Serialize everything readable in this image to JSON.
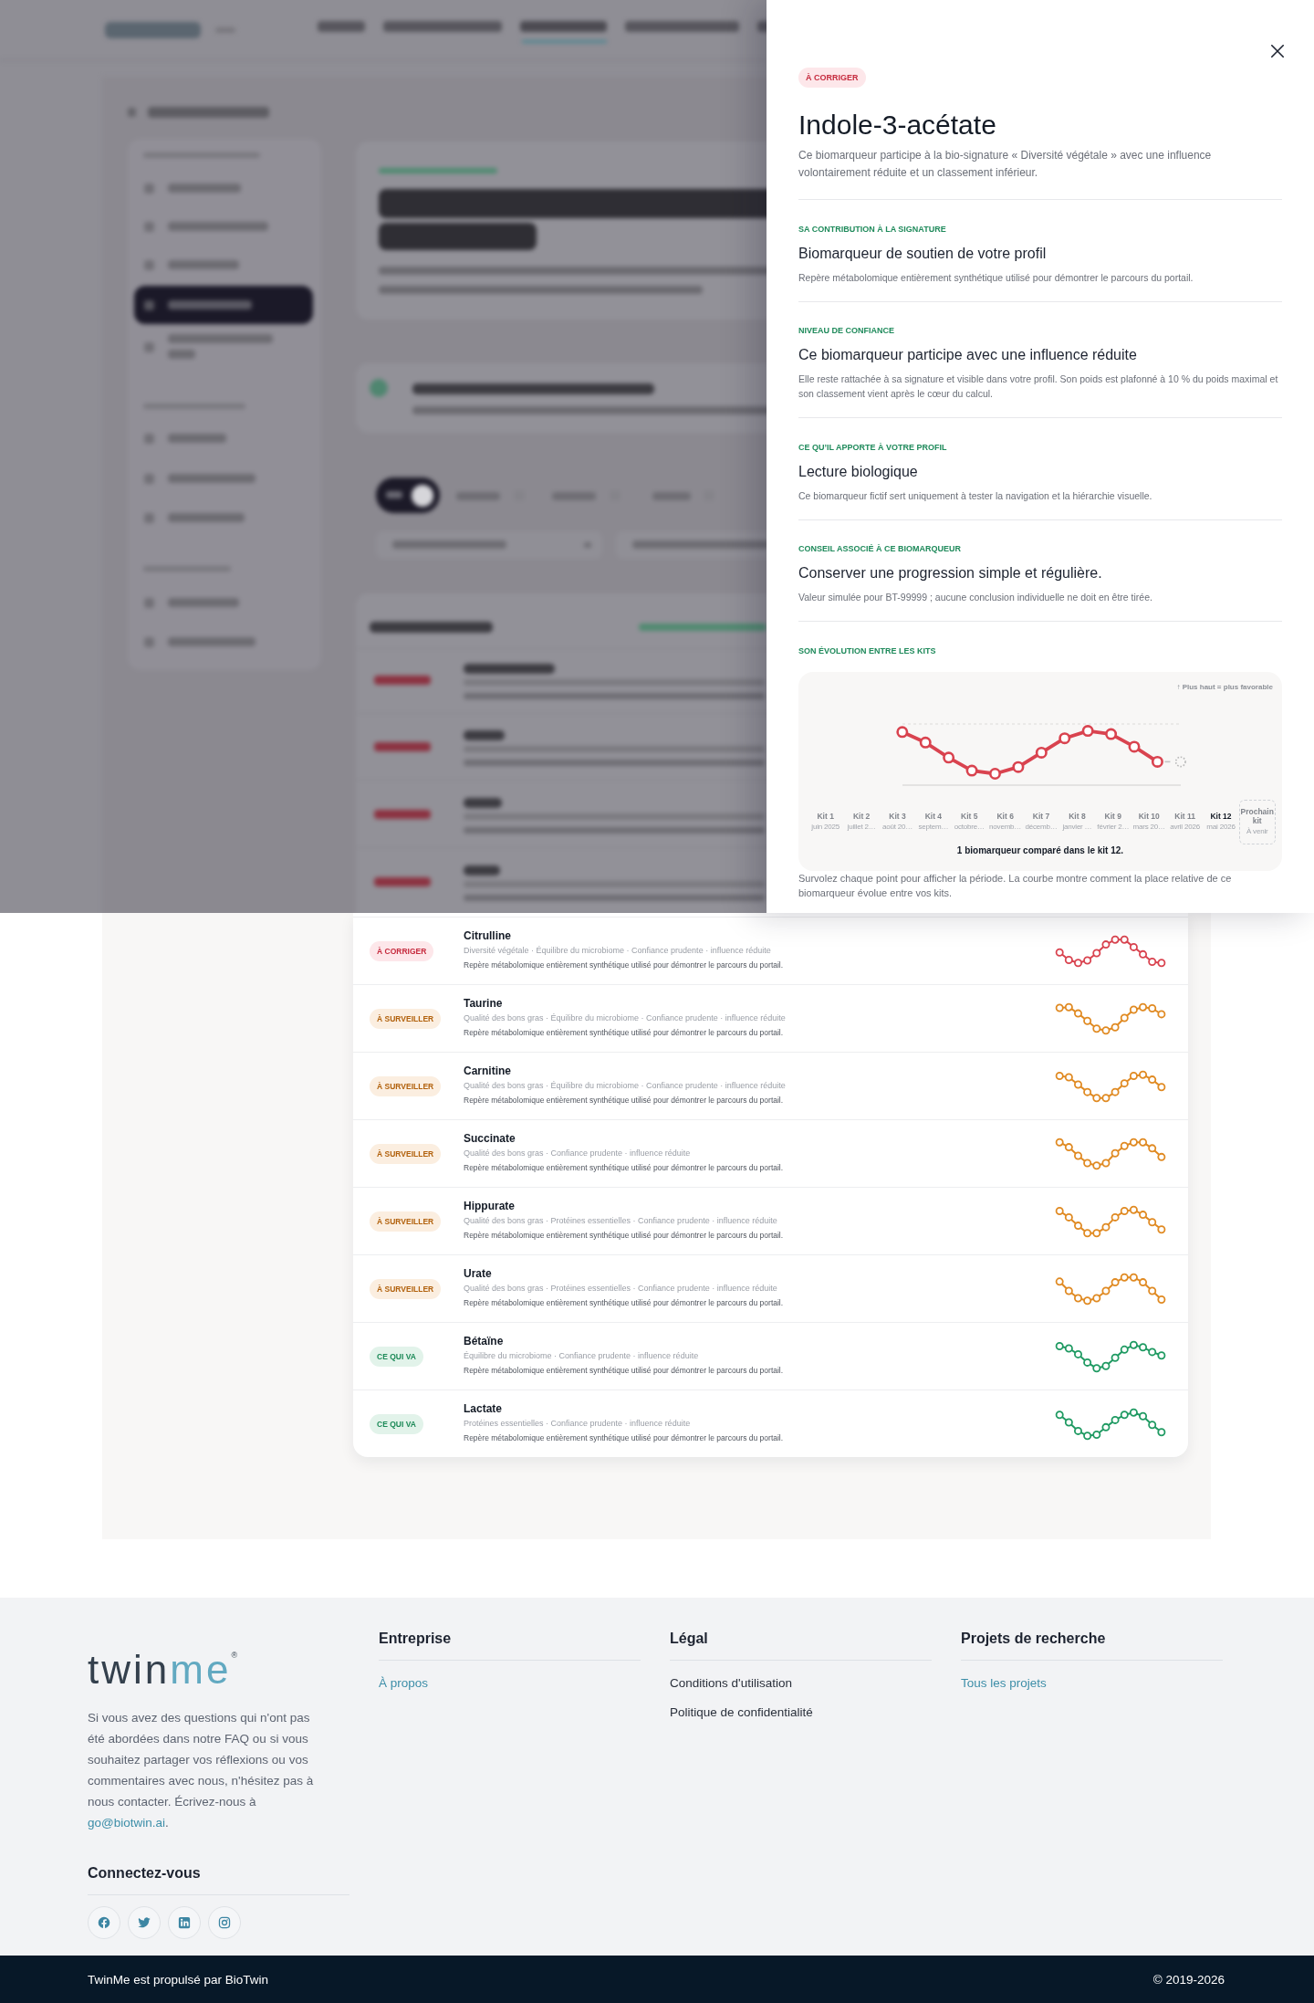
{
  "drawer": {
    "status": {
      "label": "À CORRIGER",
      "kind": "alert"
    },
    "title": "Indole-3-acétate",
    "description": "Ce biomarqueur participe à la bio-signature « Diversité végétale » avec une influence volontairement réduite et un classement inférieur.",
    "sections": [
      {
        "label": "SA CONTRIBUTION À LA SIGNATURE",
        "heading": "Biomarqueur de soutien de votre profil",
        "text": "Repère métabolomique entièrement synthétique utilisé pour démontrer le parcours du portail."
      },
      {
        "label": "NIVEAU DE CONFIANCE",
        "heading": "Ce biomarqueur participe avec une influence réduite",
        "text": "Elle reste rattachée à sa signature et visible dans votre profil. Son poids est plafonné à 10 % du poids maximal et son classement vient après le cœur du calcul."
      },
      {
        "label": "CE QU’IL APPORTE À VOTRE PROFIL",
        "heading": "Lecture biologique",
        "text": "Ce biomarqueur fictif sert uniquement à tester la navigation et la hiérarchie visuelle."
      },
      {
        "label": "CONSEIL ASSOCIÉ À CE BIOMARQUEUR",
        "heading": "Conserver une progression simple et régulière.",
        "text": "Valeur simulée pour BT-99999 ; aucune conclusion individuelle ne doit en être tirée."
      }
    ],
    "evolution": {
      "label": "SON ÉVOLUTION ENTRE LES KITS",
      "legend": "↑ Plus haut = plus favorable",
      "kits": [
        {
          "label": "Kit 1",
          "date": "juin 2025",
          "selected": false
        },
        {
          "label": "Kit 2",
          "date": "juillet 2…",
          "selected": false
        },
        {
          "label": "Kit 3",
          "date": "août 20…",
          "selected": false
        },
        {
          "label": "Kit 4",
          "date": "septem…",
          "selected": false
        },
        {
          "label": "Kit 5",
          "date": "octobre…",
          "selected": false
        },
        {
          "label": "Kit 6",
          "date": "novemb…",
          "selected": false
        },
        {
          "label": "Kit 7",
          "date": "décemb…",
          "selected": false
        },
        {
          "label": "Kit 8",
          "date": "janvier …",
          "selected": false
        },
        {
          "label": "Kit 9",
          "date": "février 2…",
          "selected": false
        },
        {
          "label": "Kit 10",
          "date": "mars 20…",
          "selected": false
        },
        {
          "label": "Kit 11",
          "date": "avril 2026",
          "selected": false
        },
        {
          "label": "Kit 12",
          "date": "mai 2026",
          "selected": true
        }
      ],
      "next_kit": {
        "label": "Prochain kit",
        "note": "À venir"
      },
      "summary": "1 biomarqueur comparé dans le kit 12.",
      "caption": "Survolez chaque point pour afficher la période. La courbe montre comment la place relative de ce biomarqueur évolue entre vos kits."
    }
  },
  "biomarkers": [
    {
      "status": "À CORRIGER",
      "kind": "alert",
      "name": "Citrulline",
      "tags": "Diversité végétale · Équilibre du microbiome · Confiance prudente · influence réduite",
      "description": "Repère métabolomique entièrement synthétique utilisé pour démontrer le parcours du portail."
    },
    {
      "status": "À SURVEILLER",
      "kind": "watch",
      "name": "Taurine",
      "tags": "Qualité des bons gras · Équilibre du microbiome · Confiance prudente · influence réduite",
      "description": "Repère métabolomique entièrement synthétique utilisé pour démontrer le parcours du portail."
    },
    {
      "status": "À SURVEILLER",
      "kind": "watch",
      "name": "Carnitine",
      "tags": "Qualité des bons gras · Équilibre du microbiome · Confiance prudente · influence réduite",
      "description": "Repère métabolomique entièrement synthétique utilisé pour démontrer le parcours du portail."
    },
    {
      "status": "À SURVEILLER",
      "kind": "watch",
      "name": "Succinate",
      "tags": "Qualité des bons gras · Confiance prudente · influence réduite",
      "description": "Repère métabolomique entièrement synthétique utilisé pour démontrer le parcours du portail."
    },
    {
      "status": "À SURVEILLER",
      "kind": "watch",
      "name": "Hippurate",
      "tags": "Qualité des bons gras · Protéines essentielles · Confiance prudente · influence réduite",
      "description": "Repère métabolomique entièrement synthétique utilisé pour démontrer le parcours du portail."
    },
    {
      "status": "À SURVEILLER",
      "kind": "watch",
      "name": "Urate",
      "tags": "Qualité des bons gras · Protéines essentielles · Confiance prudente · influence réduite",
      "description": "Repère métabolomique entièrement synthétique utilisé pour démontrer le parcours du portail."
    },
    {
      "status": "CE QUI VA",
      "kind": "good",
      "name": "Bétaïne",
      "tags": "Équilibre du microbiome · Confiance prudente · influence réduite",
      "description": "Repère métabolomique entièrement synthétique utilisé pour démontrer le parcours du portail."
    },
    {
      "status": "CE QUI VA",
      "kind": "good",
      "name": "Lactate",
      "tags": "Protéines essentielles · Confiance prudente · influence réduite",
      "description": "Repère métabolomique entièrement synthétique utilisé pour démontrer le parcours du portail."
    }
  ],
  "footer": {
    "logo": {
      "primary": "twin",
      "accent": "me",
      "mark": "®"
    },
    "contact": {
      "text": "Si vous avez des questions qui n'ont pas été abordées dans notre FAQ ou si vous souhaitez partager vos réflexions ou vos commentaires avec nous, n'hésitez pas à nous contacter. Écrivez-nous à",
      "email": "go@biotwin.ai",
      "end": "."
    },
    "social_heading": "Connectez-vous",
    "columns": [
      {
        "heading": "Entreprise",
        "links": [
          {
            "label": "À propos",
            "kind": "accent"
          }
        ]
      },
      {
        "heading": "Légal",
        "links": [
          {
            "label": "Conditions d'utilisation",
            "kind": "plain"
          },
          {
            "label": "Politique de confidentialité",
            "kind": "plain"
          }
        ]
      },
      {
        "heading": "Projets de recherche",
        "links": [
          {
            "label": "Tous les projets",
            "kind": "accent"
          }
        ]
      }
    ],
    "bottom": {
      "credit": "TwinMe est propulsé par BioTwin",
      "copyright": "© 2019-2026"
    }
  }
}
